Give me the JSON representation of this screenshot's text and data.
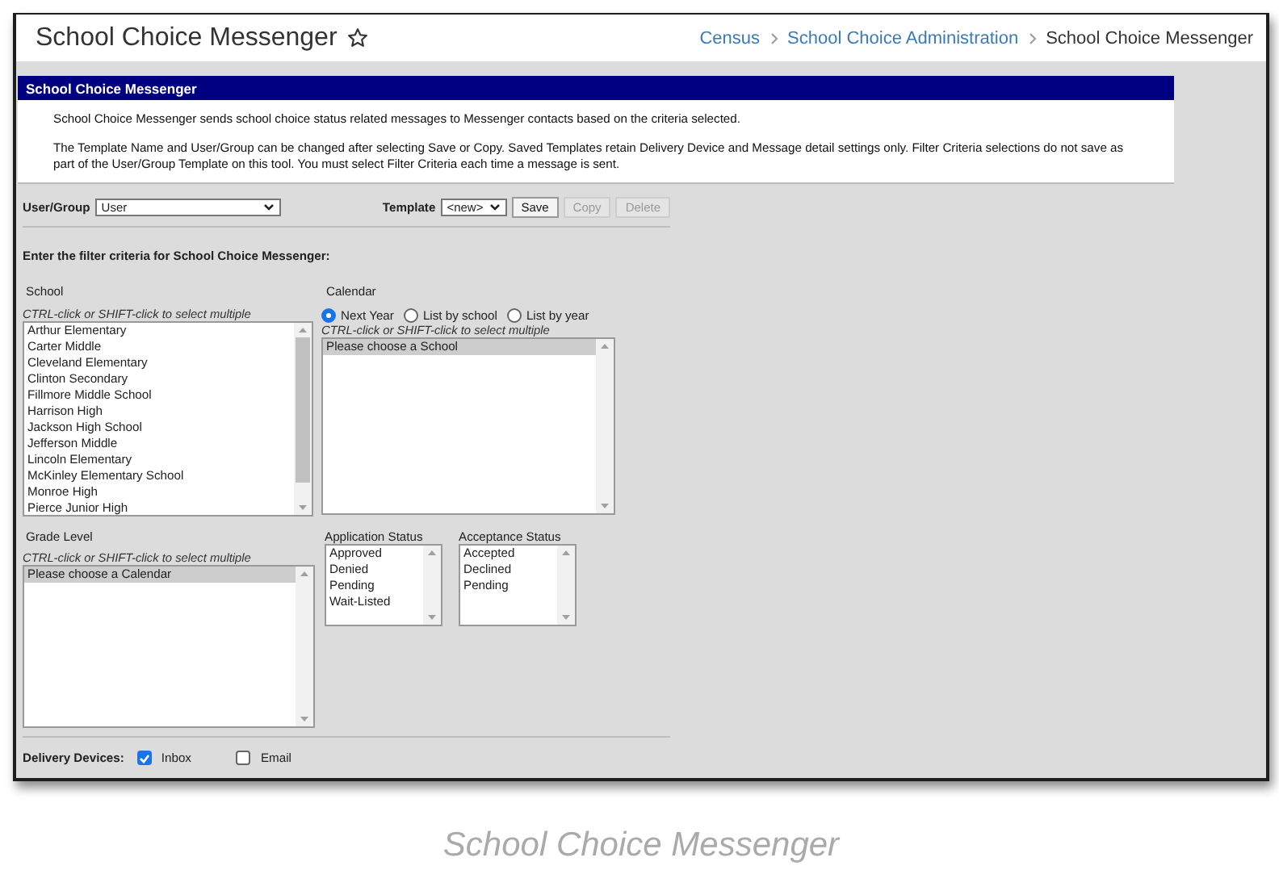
{
  "header": {
    "title": "School Choice Messenger",
    "favorite": false,
    "breadcrumb": [
      {
        "label": "Census",
        "link": true
      },
      {
        "label": "School Choice Administration",
        "link": true
      },
      {
        "label": "School Choice Messenger",
        "link": false
      }
    ]
  },
  "panel": {
    "title": "School Choice Messenger",
    "paragraphs": [
      "School Choice Messenger sends school choice status related messages to Messenger contacts based on the criteria selected.",
      "The Template Name and User/Group can be changed after selecting Save or Copy. Saved Templates retain Delivery Device and Message detail settings only. Filter Criteria selections do not save as part of the User/Group Template on this tool. You must select Filter Criteria each time a message is sent."
    ]
  },
  "user_group": {
    "label": "User/Group",
    "value": "User"
  },
  "template": {
    "label": "Template",
    "value": "<new>",
    "buttons": [
      {
        "label": "Save",
        "disabled": false
      },
      {
        "label": "Copy",
        "disabled": true
      },
      {
        "label": "Delete",
        "disabled": true
      }
    ]
  },
  "filter_heading": "Enter the filter criteria for School Choice Messenger:",
  "school": {
    "label": "School",
    "hint": "CTRL-click or SHIFT-click to select multiple",
    "options": [
      {
        "label": "Arthur Elementary",
        "selected": false
      },
      {
        "label": "Carter Middle",
        "selected": false
      },
      {
        "label": "Cleveland Elementary",
        "selected": false
      },
      {
        "label": "Clinton Secondary",
        "selected": false
      },
      {
        "label": "Fillmore Middle School",
        "selected": false
      },
      {
        "label": "Harrison High",
        "selected": false
      },
      {
        "label": "Jackson High School",
        "selected": false
      },
      {
        "label": "Jefferson Middle",
        "selected": false
      },
      {
        "label": "Lincoln Elementary",
        "selected": false
      },
      {
        "label": "McKinley Elementary School",
        "selected": false
      },
      {
        "label": "Monroe High",
        "selected": false
      },
      {
        "label": "Pierce Junior High",
        "selected": false
      }
    ]
  },
  "calendar": {
    "label": "Calendar",
    "radios": [
      {
        "label": "Next Year",
        "selected": true
      },
      {
        "label": "List by school",
        "selected": false
      },
      {
        "label": "List by year",
        "selected": false
      }
    ],
    "hint": "CTRL-click or SHIFT-click to select multiple",
    "options": [
      {
        "label": "Please choose a School",
        "selected": true
      }
    ]
  },
  "grade_level": {
    "label": "Grade Level",
    "hint": "CTRL-click or SHIFT-click to select multiple",
    "options": [
      {
        "label": "Please choose a Calendar",
        "selected": true
      }
    ]
  },
  "application_status": {
    "label": "Application Status",
    "options": [
      {
        "label": "Approved",
        "selected": false
      },
      {
        "label": "Denied",
        "selected": false
      },
      {
        "label": "Pending",
        "selected": false
      },
      {
        "label": "Wait-Listed",
        "selected": false
      }
    ]
  },
  "acceptance_status": {
    "label": "Acceptance Status",
    "options": [
      {
        "label": "Accepted",
        "selected": false
      },
      {
        "label": "Declined",
        "selected": false
      },
      {
        "label": "Pending",
        "selected": false
      }
    ]
  },
  "delivery_devices": {
    "label": "Delivery Devices:",
    "options": [
      {
        "label": "Inbox",
        "checked": true
      },
      {
        "label": "Email",
        "checked": false
      }
    ]
  },
  "caption": "School Choice Messenger"
}
